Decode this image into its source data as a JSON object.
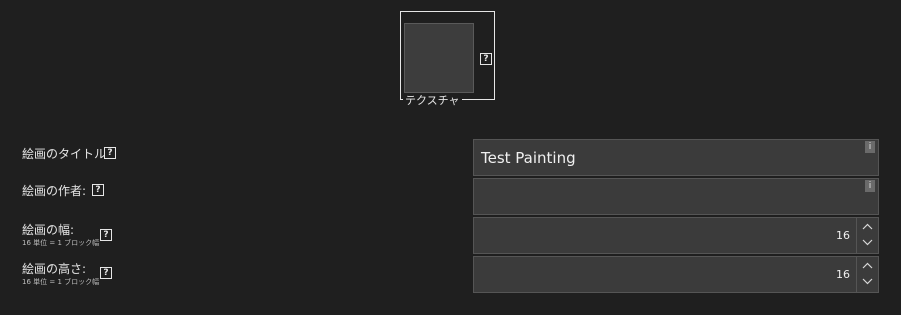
{
  "texture": {
    "label": "テクスチャ",
    "help_icon": "?",
    "swatch_color": "#3d3d3d"
  },
  "fields": {
    "title": {
      "label": "絵画のタイトル:",
      "help_icon": "?",
      "value": "Test Painting",
      "info_icon": "i"
    },
    "author": {
      "label": "絵画の作者:",
      "help_icon": "?",
      "value": "",
      "info_icon": "i"
    },
    "width": {
      "label": "絵画の幅:",
      "sublabel": "16 単位 = 1 ブロック幅",
      "help_icon": "?",
      "value": "16"
    },
    "height": {
      "label": "絵画の高さ:",
      "sublabel": "16 単位 = 1 ブロック幅",
      "help_icon": "?",
      "value": "16"
    }
  },
  "icons": {
    "help": "help-icon",
    "info": "info-icon",
    "increment": "chevron-up-icon",
    "decrement": "chevron-down-icon"
  },
  "colors": {
    "background": "#1f1f1f",
    "field_background": "#3b3b3b",
    "field_border": "#555555",
    "text": "#e6e6e6"
  }
}
